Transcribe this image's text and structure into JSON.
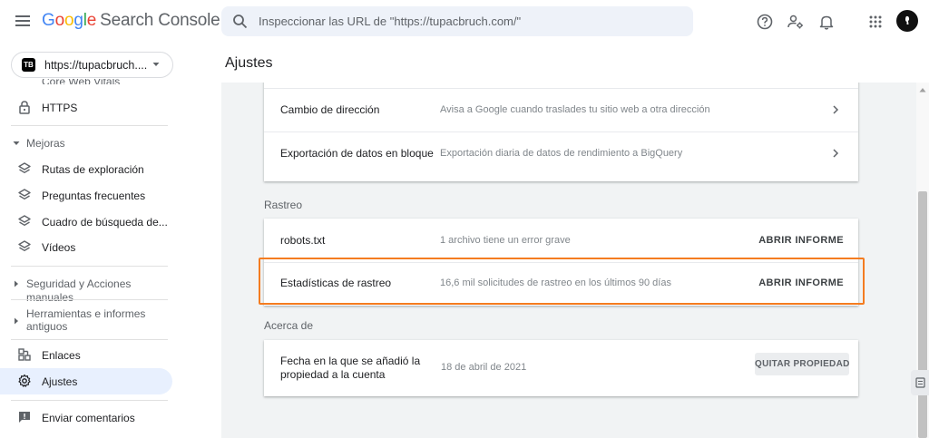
{
  "header": {
    "logo_letters": [
      "G",
      "o",
      "o",
      "g",
      "l",
      "e"
    ],
    "product": "Search Console",
    "search_placeholder": "Inspeccionar las URL de \"https://tupacbruch.com/\""
  },
  "sidebar": {
    "property": {
      "logo_text": "TB",
      "url": "https://tupacbruch...."
    },
    "cut_item": "Core Web Vitals",
    "https_label": "HTTPS",
    "mejoras_label": "Mejoras",
    "mejoras_items": [
      "Rutas de exploración",
      "Preguntas frecuentes",
      "Cuadro de búsqueda de...",
      "Vídeos"
    ],
    "seguridad_label": "Seguridad y Acciones manuales",
    "herramientas_label_1": "Herramientas e informes",
    "herramientas_label_2": "antiguos",
    "enlaces_label": "Enlaces",
    "ajustes_label": "Ajustes",
    "feedback_label": "Enviar comentarios"
  },
  "main": {
    "title": "Ajustes",
    "top_card": [
      {
        "title": "Cambio de dirección",
        "desc": "Avisa a Google cuando traslades tu sitio web a otra dirección"
      },
      {
        "title": "Exportación de datos en bloque",
        "desc": "Exportación diaria de datos de rendimiento a BigQuery"
      }
    ],
    "rastreo_label": "Rastreo",
    "rastreo_card": [
      {
        "title": "robots.txt",
        "desc": "1 archivo tiene un error grave",
        "action": "ABRIR INFORME"
      },
      {
        "title": "Estadísticas de rastreo",
        "desc": "16,6 mil solicitudes de rastreo en los últimos 90 días",
        "action": "ABRIR INFORME"
      }
    ],
    "acerca_label": "Acerca de",
    "acerca_card": {
      "title_1": "Fecha en la que se añadió la",
      "title_2": "propiedad a la cuenta",
      "value": "18 de abril de 2021",
      "action": "QUITAR PROPIEDAD"
    }
  },
  "colors": {
    "highlight": "#f47c20",
    "active_nav_bg": "#e8f0fe",
    "content_bg": "#f1f3f4"
  }
}
